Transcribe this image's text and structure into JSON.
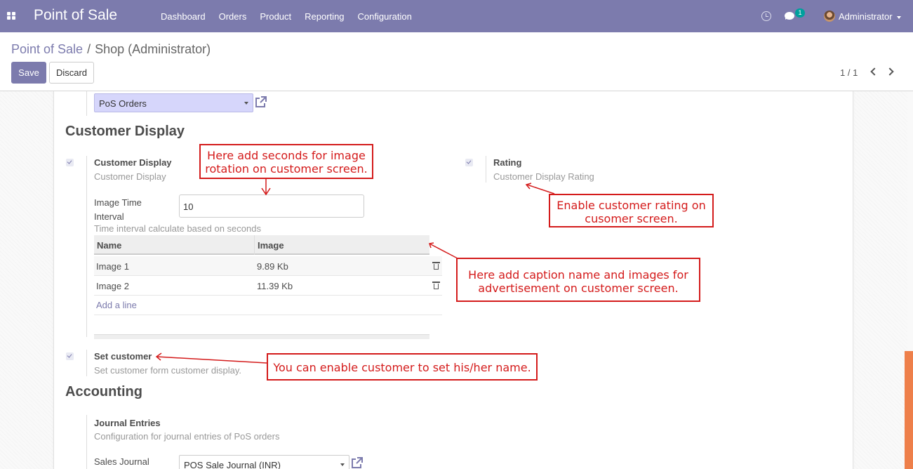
{
  "navbar": {
    "app_title": "Point of Sale",
    "menu": [
      "Dashboard",
      "Orders",
      "Product",
      "Reporting",
      "Configuration"
    ],
    "messages_badge": "1",
    "user": "Administrator"
  },
  "control_panel": {
    "breadcrumb_parent": "Point of Sale",
    "breadcrumb_separator": "/",
    "breadcrumb_current": "Shop (Administrator)",
    "save_label": "Save",
    "discard_label": "Discard",
    "pager": "1 / 1"
  },
  "form": {
    "top_select_value": "PoS Orders",
    "customer_display_section": "Customer Display",
    "customer_display": {
      "label": "Customer Display",
      "help": "Customer Display",
      "checked": true
    },
    "image_time_interval": {
      "label_line1": "Image Time",
      "label_line2": "Interval",
      "value": "10",
      "help": "Time interval calculate based on seconds"
    },
    "image_table": {
      "columns": [
        "Name",
        "Image"
      ],
      "rows": [
        {
          "name": "Image 1",
          "image": "9.89 Kb"
        },
        {
          "name": "Image 2",
          "image": "11.39 Kb"
        }
      ],
      "add_line": "Add a line"
    },
    "rating": {
      "label": "Rating",
      "help": "Customer Display Rating",
      "checked": true
    },
    "set_customer": {
      "label": "Set customer",
      "help": "Set customer form customer display.",
      "checked": true
    },
    "accounting_section": "Accounting",
    "journal_entries": {
      "label": "Journal Entries",
      "help": "Configuration for journal entries of PoS orders"
    },
    "sales_journal": {
      "label": "Sales Journal",
      "value": "POS Sale Journal (INR)"
    }
  },
  "annotations": {
    "seconds_note_line1": "Here add seconds for image",
    "seconds_note_line2": "rotation on customer screen.",
    "rating_note_line1": "Enable customer rating on",
    "rating_note_line2": "cusomer screen.",
    "images_note_line1": "Here add caption name and images for",
    "images_note_line2": "advertisement on customer screen.",
    "customer_note": "You can enable customer to set his/her name.",
    "color": "#d41b1b"
  },
  "colors": {
    "brand": "#7c7bad",
    "scrollbar": "#ee7f4a",
    "badge": "#00a09d"
  }
}
